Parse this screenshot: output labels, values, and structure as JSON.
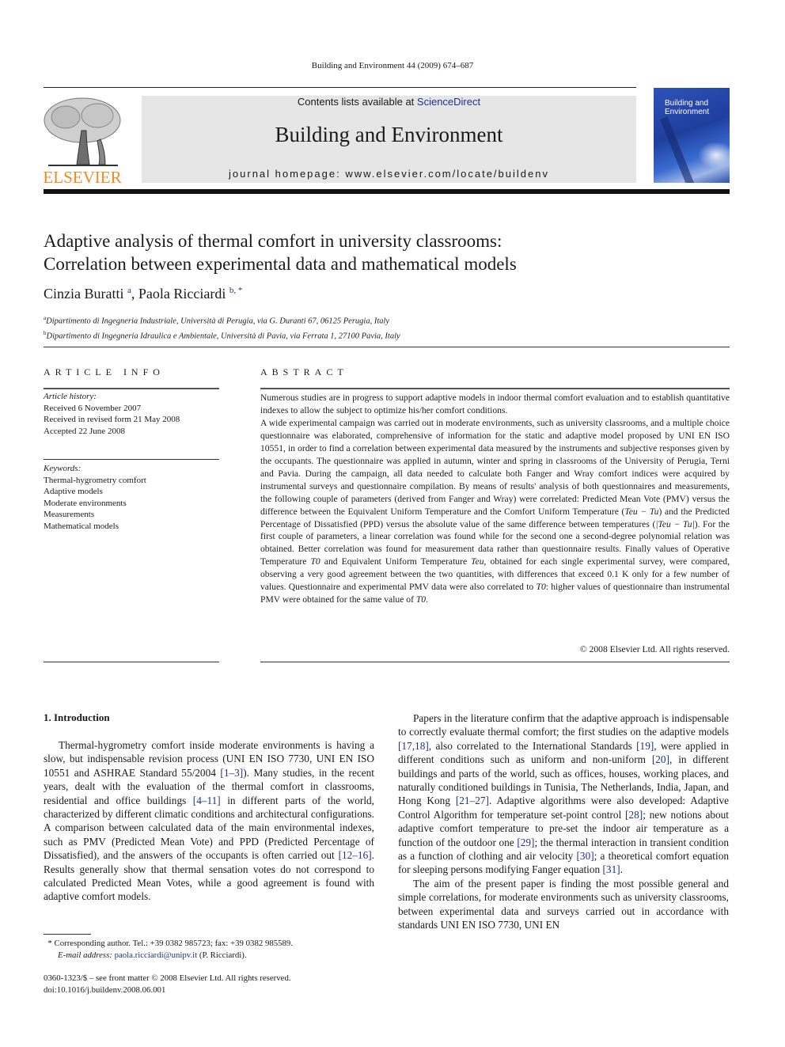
{
  "journal_ref": "Building and Environment 44 (2009) 674–687",
  "banner": {
    "contents_prefix": "Contents lists available at ",
    "contents_link": "ScienceDirect",
    "journal_name": "Building and Environment",
    "homepage": "journal homepage: www.elsevier.com/locate/buildenv"
  },
  "publisher": {
    "name": "ELSEVIER",
    "color": "#f28a1e"
  },
  "cover": {
    "title_line1": "Building and",
    "title_line2": "Environment"
  },
  "article": {
    "title_line1": "Adaptive analysis of thermal comfort in university classrooms:",
    "title_line2": "Correlation between experimental data and mathematical models",
    "authors": [
      {
        "name": "Cinzia Buratti",
        "sup": "a"
      },
      {
        "name": "Paola Ricciardi",
        "sup": "b, *"
      }
    ],
    "affiliations": [
      {
        "sup": "a",
        "text": "Dipartimento di Ingegneria Industriale, Università di Perugia, via G. Duranti 67, 06125 Perugia, Italy"
      },
      {
        "sup": "b",
        "text": "Dipartimento di Ingegneria Idraulica e Ambientale, Università di Pavia, via Ferrata 1, 27100 Pavia, Italy"
      }
    ]
  },
  "article_info": {
    "heading": "ARTICLE INFO",
    "history_label": "Article history:",
    "history": [
      "Received 6 November 2007",
      "Received in revised form 21 May 2008",
      "Accepted 22 June 2008"
    ],
    "keywords_label": "Keywords:",
    "keywords": [
      "Thermal-hygrometry comfort",
      "Adaptive models",
      "Moderate environments",
      "Measurements",
      "Mathematical models"
    ]
  },
  "abstract": {
    "heading": "ABSTRACT",
    "p1": "Numerous studies are in progress to support adaptive models in indoor thermal comfort evaluation and to establish quantitative indexes to allow the subject to optimize his/her comfort conditions.",
    "p2a": "A wide experimental campaign was carried out in moderate environments, such as university class­rooms, and a multiple choice questionnaire was elaborated, comprehensive of information for the static and adaptive model proposed by UNI EN ISO 10551, in order to find a correlation between experimental data measured by the instruments and subjective responses given by the occupants. The questionnaire was applied in autumn, winter and spring in classrooms of the University of Perugia, Terni and Pavia. During the campaign, all data needed to calculate both Fanger and Wray comfort indices were acquired by instrumental surveys and questionnaire compilation. By means of results' analysis of both ques­tionnaires and measurements, the following couple of parameters (derived from Fanger and Wray) were correlated: Predicted Mean Vote (PMV) versus the difference between the Equivalent Uniform Temperature and the Comfort Uniform Temperature (",
    "p2b": ") and the Predicted Percentage of Dissat­isfied (PPD) versus the absolute value of the same difference between temperatures (",
    "p2c": "). For the first couple of parameters, a linear correlation was found while for the second one a second-degree polynomial relation was obtained. Better correlation was found for measurement data rather than questionnaire results. Finally values of Operative Temperature ",
    "p2d": " and Equivalent Uniform Temperature ",
    "p2e": ", obtained for each single experimental survey, were compared, observing a very good agreement between the two quantities, with differences that exceed 0.1 K only for a few number of values. Ques­tionnaire and experimental PMV data were also correlated to ",
    "p2f": ": higher values of questionnaire than instrumental PMV were obtained for the same value of ",
    "p2g": ".",
    "expr_diff": "Teu − Tu",
    "expr_absdiff": "|Teu − Tu|",
    "sym_T0": "T0",
    "sym_Teu": "Teu",
    "copyright": "© 2008 Elsevier Ltd. All rights reserved."
  },
  "intro": {
    "heading": "1.  Introduction",
    "left_p1": [
      "Thermal-hygrometry comfort inside moderate environments is having a slow, but indispensable revision process (UNI EN ISO 7730, UNI EN ISO 10551 and ASHRAE Standard 55/2004 ",
      "[1–3]",
      "). Many studies, in the recent years, dealt with the evaluation of the thermal comfort in classrooms, residential and office buildings ",
      "[4–11]",
      " in different parts of the world, characterized by different climatic conditions and architectural configurations. A comparison between calculated data of the main environmental indexes, such as PMV (Predicted Mean Vote) and PPD (Predicted Percentage of Dissatis­fied), and the answers of the occupants is often carried out ",
      "[12–16]",
      ". Results generally show that thermal sensation votes do not corre­spond to calculated Predicted Mean Votes, while a good agreement is found with adaptive comfort models."
    ],
    "right_p1": [
      "Papers in the literature confirm that the adaptive approach is indispensable to correctly evaluate thermal comfort; the first studies on the adaptive models ",
      "[17,18]",
      ", also correlated to the International Standards ",
      "[19]",
      ", were applied in different conditions such as uniform and non-uniform ",
      "[20]",
      ", in different buildings and parts of the world, such as offices, houses, working places, and naturally conditioned buildings in Tunisia, The Netherlands, India, Japan, and Hong Kong ",
      "[21–27]",
      ". Adaptive algorithms were also developed: Adaptive Control Algorithm for temperature set-point control ",
      "[28]",
      "; new notions about adaptive comfort temperature to pre-set the indoor air temperature as a function of the outdoor one ",
      "[29]",
      "; the thermal interaction in transient condition as a function of clothing and air velocity ",
      "[30]",
      "; a theoretical comfort equation for sleeping persons modifying Fanger equation ",
      "[31]",
      "."
    ],
    "right_p2": "The aim of the present paper is finding the most possible general and simple correlations, for moderate environments such as university classrooms, between experimental data and surveys carried out in accordance with standards UNI EN ISO 7730, UNI EN"
  },
  "footnote": {
    "star": "*",
    "line1": " Corresponding author. Tel.: +39 0382 985723; fax: +39 0382 985589.",
    "email_label": "E-mail address: ",
    "email": "paola.ricciardi@unipv.it",
    "email_suffix": " (P. Ricciardi)."
  },
  "frontmatter": {
    "issn_line": "0360-1323/$ – see front matter © 2008 Elsevier Ltd. All rights reserved.",
    "doi": "doi:10.1016/j.buildenv.2008.06.001"
  }
}
